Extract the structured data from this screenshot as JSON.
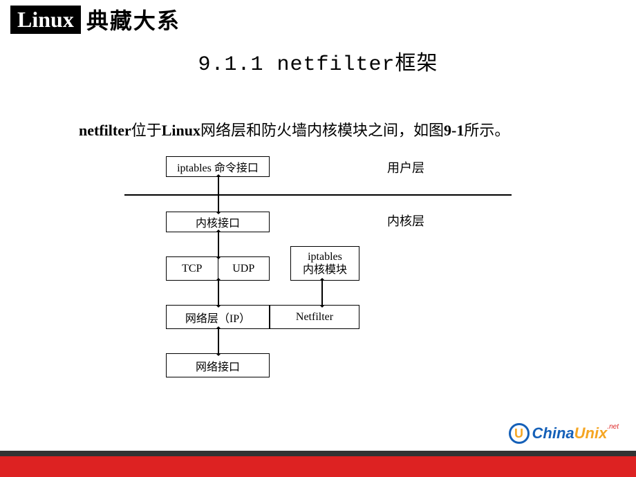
{
  "header": {
    "badge": "Linux",
    "series": "典藏大系"
  },
  "title": "9.1.1  netfilter框架",
  "body": {
    "prefix_bold": "netfilter",
    "mid1": "位于",
    "bold2": "Linux",
    "mid2": "网络层和防火墙内核模块之间，如图",
    "bold3": "9-1",
    "tail": "所示。"
  },
  "diagram": {
    "layers": {
      "user": "用户层",
      "kernel": "内核层"
    },
    "boxes": {
      "iptables_cmd": "iptables 命令接口",
      "kernel_iface": "内核接口",
      "tcp": "TCP",
      "udp": "UDP",
      "iptables_mod_l1": "iptables",
      "iptables_mod_l2": "内核模块",
      "ip_layer": "网络层（IP）",
      "netfilter": "Netfilter",
      "net_iface": "网络接口"
    }
  },
  "logo": {
    "u": "U",
    "china": "China",
    "unix": "Unix",
    "net": ".net"
  }
}
